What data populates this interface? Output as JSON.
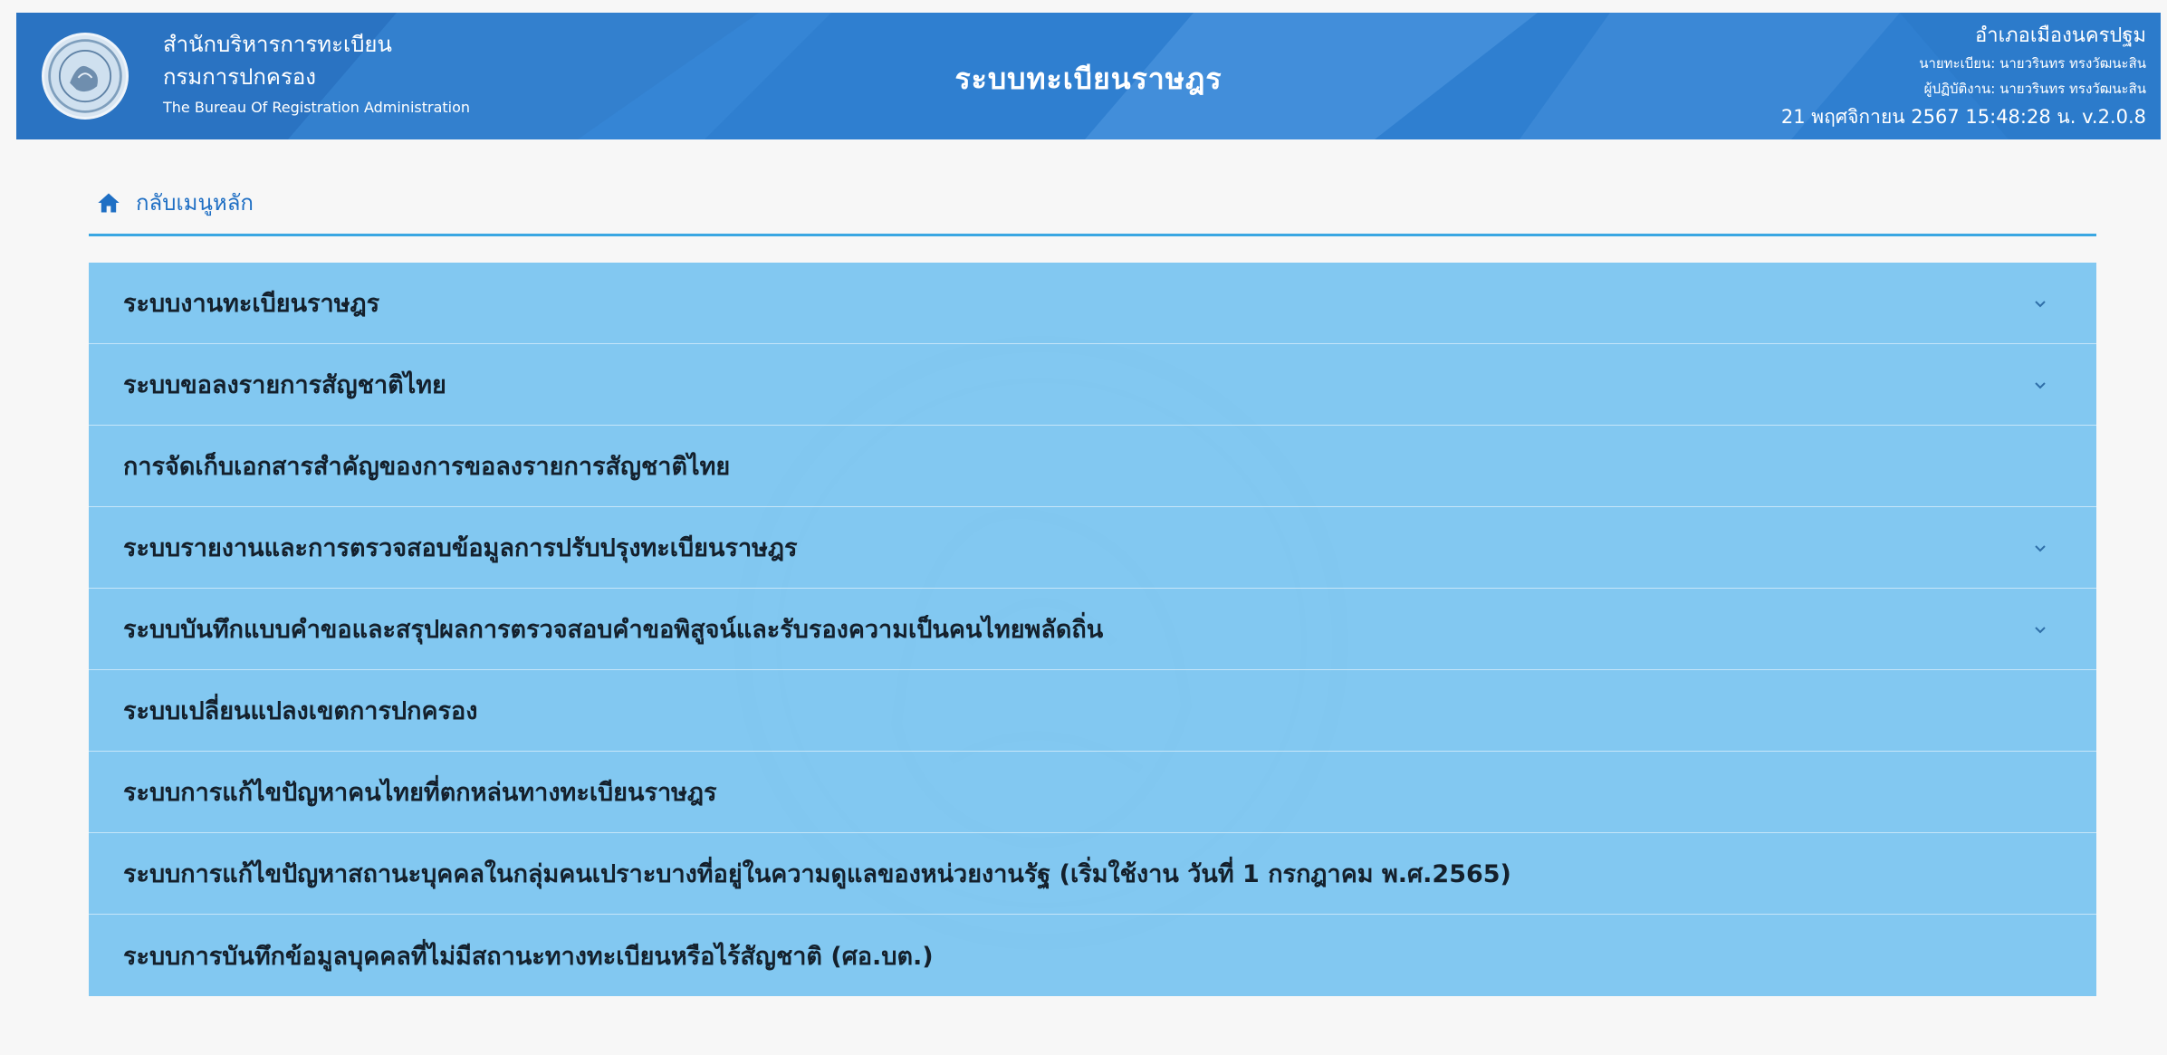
{
  "header": {
    "org_line1": "สำนักบริหารการทะเบียน",
    "org_line2": "กรมการปกครอง",
    "org_line3": "The Bureau Of Registration Administration",
    "system_title": "ระบบทะเบียนราษฎร",
    "user_line1": "อำเภอเมืองนครปฐม",
    "user_line2": "นายทะเบียน: นายวรินทร ทรงวัฒนะสิน",
    "user_line3": "ผู้ปฏิบัติงาน: นายวรินทร ทรงวัฒนะสิน",
    "user_line4": "21 พฤศจิกายน 2567 15:48:28 น.  v.2.0.8",
    "colors": {
      "primary": "#2f7fd0",
      "menu_bg": "#78c4f0"
    }
  },
  "nav": {
    "back_label": "กลับเมนูหลัก",
    "back_icon": "home-icon"
  },
  "menu": {
    "items": [
      {
        "label": "ระบบงานทะเบียนราษฎร",
        "expandable": true
      },
      {
        "label": "ระบบขอลงรายการสัญชาติไทย",
        "expandable": true
      },
      {
        "label": "การจัดเก็บเอกสารสำคัญของการขอลงรายการสัญชาติไทย",
        "expandable": false
      },
      {
        "label": "ระบบรายงานและการตรวจสอบข้อมูลการปรับปรุงทะเบียนราษฎร",
        "expandable": true
      },
      {
        "label": "ระบบบันทึกแบบคำขอและสรุปผลการตรวจสอบคำขอพิสูจน์และรับรองความเป็นคนไทยพลัดถิ่น",
        "expandable": true
      },
      {
        "label": "ระบบเปลี่ยนแปลงเขตการปกครอง",
        "expandable": false
      },
      {
        "label": "ระบบการแก้ไขปัญหาคนไทยที่ตกหล่นทางทะเบียนราษฎร",
        "expandable": false
      },
      {
        "label": "ระบบการแก้ไขปัญหาสถานะบุคคลในกลุ่มคนเปราะบางที่อยู่ในความดูแลของหน่วยงานรัฐ (เริ่มใช้งาน วันที่ 1 กรกฎาคม พ.ศ.2565)",
        "expandable": false
      },
      {
        "label": "ระบบการบันทึกข้อมูลบุคคลที่ไม่มีสถานะทางทะเบียนหรือไร้สัญชาติ (ศอ.บต.)",
        "expandable": false
      }
    ]
  }
}
